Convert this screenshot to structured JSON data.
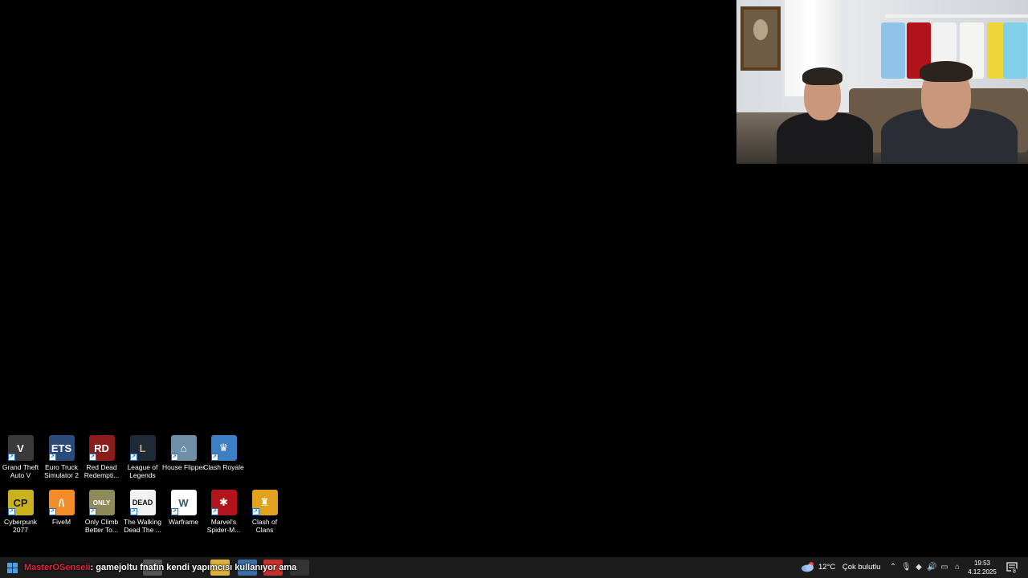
{
  "desktop_icons": [
    {
      "label": "Grand Theft Auto V",
      "icon": "gta-v-icon",
      "color": "#3a3a3a"
    },
    {
      "label": "Euro Truck Simulator 2",
      "icon": "truck-icon",
      "color": "#2a4a7a"
    },
    {
      "label": "Red Dead Redempti...",
      "icon": "red-dead-icon",
      "color": "#8a1c1c"
    },
    {
      "label": "League of Legends",
      "icon": "league-icon",
      "color": "#1e2a38"
    },
    {
      "label": "House Flipper",
      "icon": "house-flipper-icon",
      "color": "#6f8fa8"
    },
    {
      "label": "Clash Royale",
      "icon": "clash-royale-icon",
      "color": "#3d7fc4"
    },
    {
      "label": "Cyberpunk 2077",
      "icon": "cyberpunk-icon",
      "color": "#c9b21e"
    },
    {
      "label": "FiveM",
      "icon": "fivem-icon",
      "color": "#f28c28"
    },
    {
      "label": "Only Climb Better To...",
      "icon": "only-climb-icon",
      "color": "#8e8a5a"
    },
    {
      "label": "The Walking Dead The ...",
      "icon": "walking-dead-icon",
      "color": "#f2f2f2"
    },
    {
      "label": "Warframe",
      "icon": "warframe-icon",
      "color": "#ffffff"
    },
    {
      "label": "Marvel's Spider-M...",
      "icon": "spiderman-icon",
      "color": "#b3141c"
    },
    {
      "label": "Clash of Clans",
      "icon": "clash-of-clans-icon",
      "color": "#e0a21f"
    }
  ],
  "taskbar": {
    "chat_user": "MasterOSenseii",
    "chat_message": ": gamejoltu fnafın kendi yapımcısı kullanıyor ama",
    "weather_temp": "12°C",
    "weather_desc": "Çok bulutlu",
    "time": "19:53",
    "date": "4.12.2025",
    "notification_count": "8"
  }
}
